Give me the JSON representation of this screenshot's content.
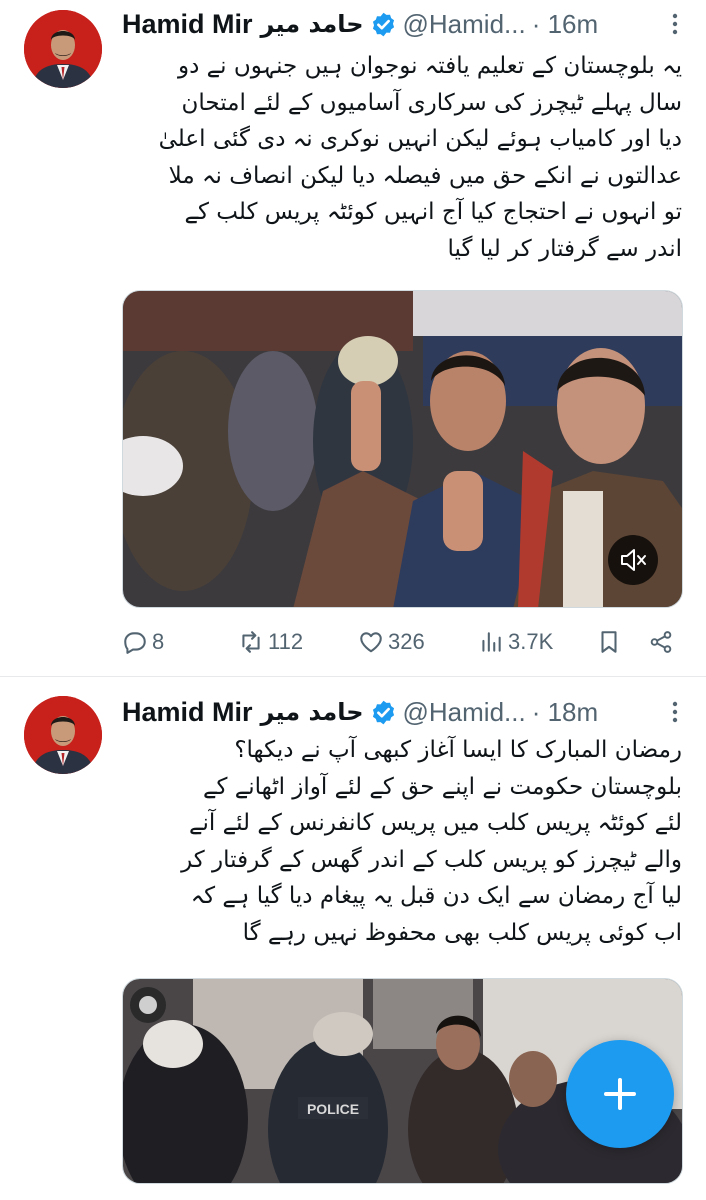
{
  "colors": {
    "brand_blue": "#1d9bf0",
    "text_primary": "#0f1419",
    "text_secondary": "#536471",
    "divider": "#e7e9ea"
  },
  "tweets": [
    {
      "author_name": "Hamid Mir",
      "author_name_urdu": "حامد میر",
      "handle": "@Hamid...",
      "time": "· 16m",
      "more_icon": "more-vertical-icon",
      "text_lines": [
        "یہ بلوچستان کے تعلیم یافتہ نوجوان ہیں جنہوں نے دو",
        "سال پہلے ٹیچرز کی سرکاری آسامیوں کے لئے امتحان",
        "دیا اور کامیاب ہوئے لیکن انہیں نوکری نہ دی گئی اعلیٰ",
        "عدالتوں نے انکے حق میں فیصلہ دیا لیکن انصاف نہ ملا",
        "تو انہوں نے احتجاج کیا آج انہیں کوئٹہ پریس کلب کے",
        "اندر سے گرفتار کر لیا گیا"
      ],
      "media": {
        "type": "video",
        "mute_icon": "volume-muted-icon"
      },
      "stats": {
        "replies": "8",
        "retweets": "112",
        "likes": "326",
        "views": "3.7K"
      }
    },
    {
      "author_name": "Hamid Mir",
      "author_name_urdu": "حامد میر",
      "handle": "@Hamid...",
      "time": "· 18m",
      "more_icon": "more-vertical-icon",
      "text_lines": [
        "رمضان المبارک کا ایسا آغاز کبھی آپ نے دیکھا؟",
        "بلوچستان حکومت نے اپنے حق کے لئے آواز اٹھانے کے",
        "لئے کوئٹہ پریس کلب میں پریس کانفرنس کے لئے آنے",
        "والے ٹیچرز کو پریس کلب کے اندر گھس کے گرفتار کر",
        "لیا آج رمضان سے ایک دن قبل یہ پیغام دیا گیا ہے کہ",
        "اب کوئی پریس کلب بھی محفوظ نہیں رہے گا"
      ],
      "media": {
        "type": "image",
        "overlay_text": "POLICE"
      }
    }
  ],
  "fab": {
    "icon": "plus-icon",
    "action": "compose"
  }
}
